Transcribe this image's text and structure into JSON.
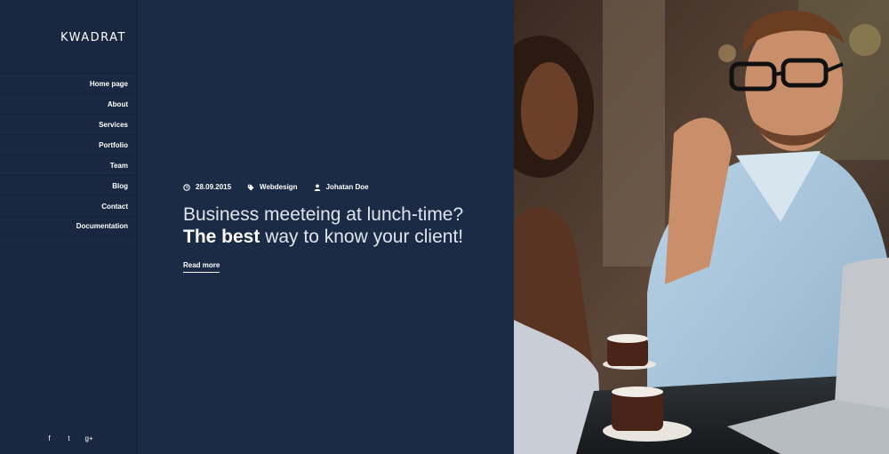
{
  "brand": {
    "logo": "KWADRAT"
  },
  "nav": {
    "items": [
      {
        "label": "Home page"
      },
      {
        "label": "About"
      },
      {
        "label": "Services"
      },
      {
        "label": "Portfolio"
      },
      {
        "label": "Team"
      },
      {
        "label": "Blog"
      },
      {
        "label": "Contact"
      },
      {
        "label": "Documentation"
      }
    ]
  },
  "social": {
    "facebook": "f",
    "twitter": "t",
    "googleplus": "g+"
  },
  "post": {
    "date": "28.09.2015",
    "category": "Webdesign",
    "author": "Johatan Doe",
    "headline_line1": "Business meeteing at lunch-time?",
    "headline_bold": "The best",
    "headline_rest": " way to know your client!",
    "read_more": "Read more"
  },
  "colors": {
    "sidebar_bg": "#192840",
    "content_bg": "#1b2b45",
    "text": "#ffffff"
  },
  "icons": {
    "date": "clock-icon",
    "category": "tag-icon",
    "author": "user-icon",
    "facebook": "facebook-icon",
    "twitter": "twitter-icon",
    "googleplus": "google-plus-icon"
  }
}
